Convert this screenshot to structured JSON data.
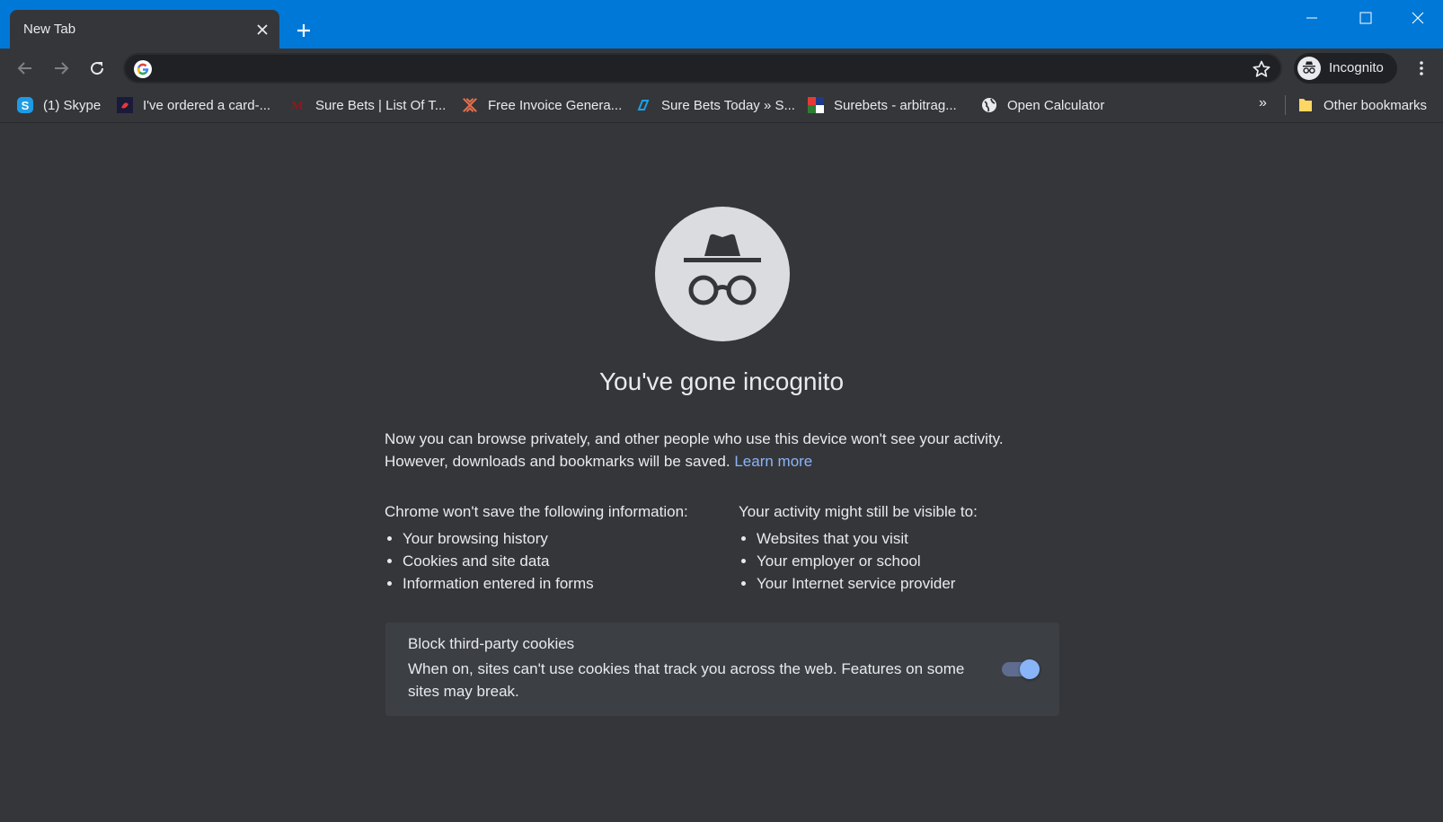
{
  "window": {
    "tab_title": "New Tab",
    "accent_color": "#0078d7"
  },
  "toolbar": {
    "address_value": "",
    "profile_label": "Incognito"
  },
  "bookmarks": {
    "items": [
      {
        "label": "(1) Skype",
        "icon": "skype-icon"
      },
      {
        "label": "I've ordered a card-...",
        "icon": "card-favicon"
      },
      {
        "label": "Sure Bets | List Of T...",
        "icon": "surebets-favicon"
      },
      {
        "label": "Free Invoice Genera...",
        "icon": "invoice-favicon"
      },
      {
        "label": "Sure Bets Today » S...",
        "icon": "surebets-today-favicon"
      },
      {
        "label": "Surebets - arbitrag...",
        "icon": "arbitrage-favicon"
      },
      {
        "label": "Open Calculator",
        "icon": "globe-icon"
      }
    ],
    "overflow_label": "»",
    "other_label": "Other bookmarks"
  },
  "page": {
    "title": "You've gone incognito",
    "intro_line1": "Now you can browse privately, and other people who use this device won't see your activity.",
    "intro_line2": "However, downloads and bookmarks will be saved.",
    "learn_more": "Learn more",
    "left_heading": "Chrome won't save the following information:",
    "left_items": [
      "Your browsing history",
      "Cookies and site data",
      "Information entered in forms"
    ],
    "right_heading": "Your activity might still be visible to:",
    "right_items": [
      "Websites that you visit",
      "Your employer or school",
      "Your Internet service provider"
    ],
    "cookie_title": "Block third-party cookies",
    "cookie_desc": "When on, sites can't use cookies that track you across the web. Features on some sites may break.",
    "cookie_toggle_on": true
  }
}
